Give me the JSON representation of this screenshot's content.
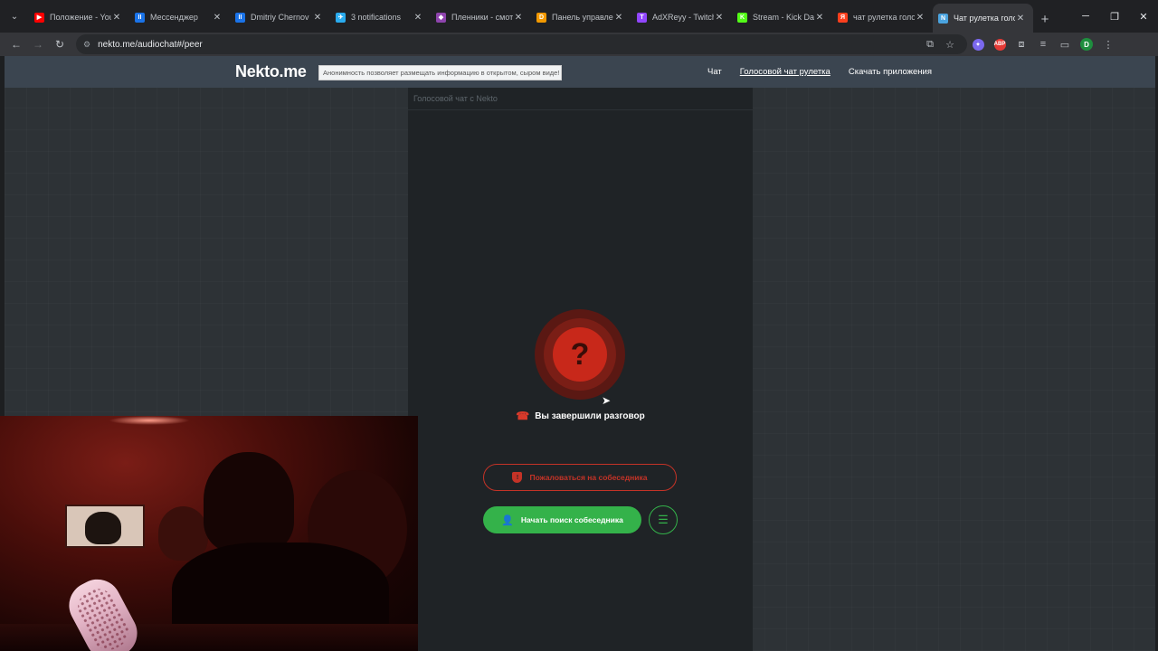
{
  "browser": {
    "tabs": [
      {
        "title": "Положение - YouTube",
        "color": "#ff0000",
        "glyph": "▶"
      },
      {
        "title": "Мессенджер",
        "color": "#1a73e8",
        "glyph": "II"
      },
      {
        "title": "Dmitriy Chernov",
        "color": "#1a73e8",
        "glyph": "II"
      },
      {
        "title": "3 notifications",
        "color": "#2aabee",
        "glyph": "✈"
      },
      {
        "title": "Пленники - смотреть",
        "color": "#8e44ad",
        "glyph": "◆"
      },
      {
        "title": "Панель управления",
        "color": "#f29900",
        "glyph": "D"
      },
      {
        "title": "AdXReyy - Twitch",
        "color": "#9146ff",
        "glyph": "T"
      },
      {
        "title": "Stream - Kick Dashboard",
        "color": "#53fc18",
        "glyph": "K"
      },
      {
        "title": "чат рулетка голосовой",
        "color": "#fc3f1d",
        "glyph": "Я"
      },
      {
        "title": "Чат рулетка голосовой",
        "color": "#4aa3df",
        "glyph": "N",
        "active": true
      }
    ],
    "close_glyph": "✕",
    "newtab_glyph": "+",
    "url": "nekto.me/audiochat#/peer",
    "profile_initial": "D",
    "ext_abp": "ABP"
  },
  "site": {
    "logo": "Nekto.me",
    "logo_tip": "Анонимность позволяет размещать информацию в открытом, сыром виде!",
    "nav": [
      {
        "label": "Чат",
        "active": false
      },
      {
        "label": "Голосовой чат рулетка",
        "active": true
      },
      {
        "label": "Скачать приложения",
        "active": false
      }
    ]
  },
  "chat": {
    "header": "Голосовой чат с Nekto",
    "status_glyph": "?",
    "ended_text": "Вы завершили разговор",
    "complain_label": "Пожаловаться на собеседника",
    "search_label": "Начать поиск собеседника"
  },
  "colors": {
    "accent_green": "#34b24a",
    "accent_red": "#c43327",
    "header_bg": "#3b4550"
  }
}
